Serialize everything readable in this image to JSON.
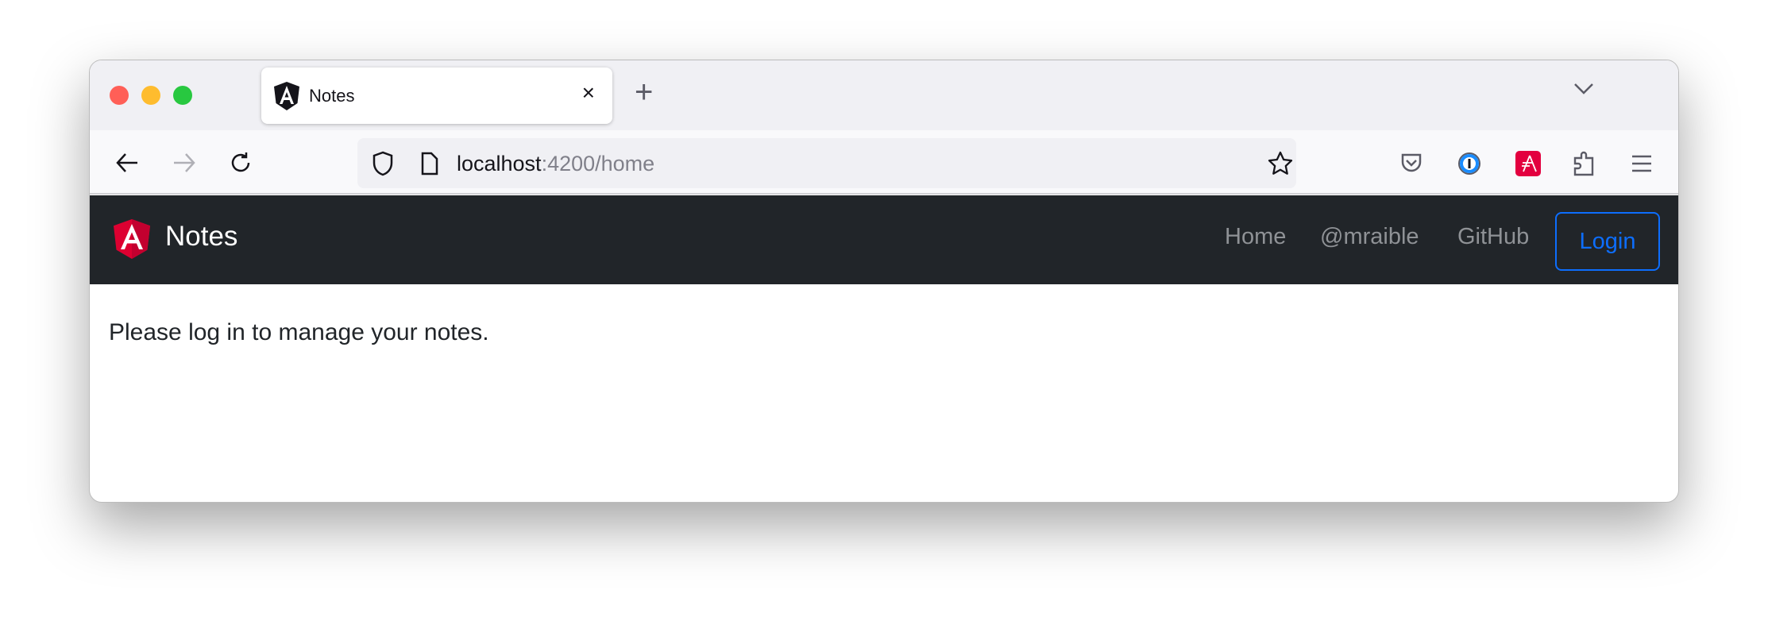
{
  "browser": {
    "tab": {
      "title": "Notes",
      "favicon": "angular-icon"
    },
    "new_tab_label": "+",
    "close_tab_label": "×",
    "address": {
      "host": "localhost",
      "rest": ":4200/home"
    },
    "toolbar_icons": [
      "back-icon",
      "forward-icon",
      "reload-icon",
      "shield-icon",
      "page-icon",
      "star-icon",
      "pocket-icon",
      "1password-icon",
      "red-extension-icon",
      "extensions-icon",
      "menu-icon"
    ]
  },
  "app": {
    "brand": "Notes",
    "nav": [
      {
        "label": "Home"
      },
      {
        "label": "@mraible"
      },
      {
        "label": "GitHub"
      }
    ],
    "login_label": "Login",
    "message": "Please log in to manage your notes.",
    "colors": {
      "navbar": "#212529",
      "primary": "#0d6efd",
      "angular": "#dd0031"
    }
  }
}
